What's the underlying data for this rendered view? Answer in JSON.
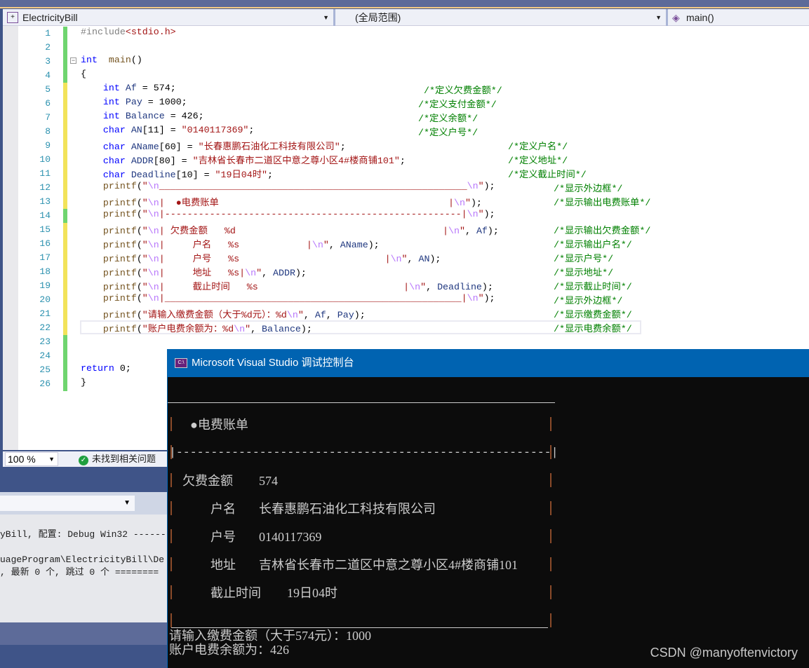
{
  "navbar": {
    "project": "ElectricityBill",
    "scope": "(全局范围)",
    "member": "main()"
  },
  "editor": {
    "line_numbers": [
      "1",
      "2",
      "3",
      "4",
      "5",
      "6",
      "7",
      "8",
      "9",
      "10",
      "11",
      "12",
      "13",
      "14",
      "15",
      "16",
      "17",
      "18",
      "19",
      "20",
      "21",
      "22",
      "23",
      "24",
      "25",
      "26"
    ],
    "change_marks": [
      "saved",
      "saved",
      "saved",
      "saved",
      "unsaved",
      "unsaved",
      "unsaved",
      "unsaved",
      "unsaved",
      "unsaved",
      "unsaved",
      "unsaved",
      "unsaved",
      "saved",
      "unsaved",
      "unsaved",
      "unsaved",
      "unsaved",
      "unsaved",
      "unsaved",
      "unsaved",
      "unsaved",
      "saved",
      "saved",
      "saved",
      "saved"
    ],
    "code": [
      [
        [
          "pp",
          "#include"
        ],
        [
          "str",
          "<stdio.h>"
        ]
      ],
      [],
      [
        [
          "kw",
          "int"
        ],
        [
          "",
          "  "
        ],
        [
          "fn",
          "main"
        ],
        [
          "",
          "()"
        ]
      ],
      [
        [
          "",
          "{"
        ]
      ],
      [
        [
          "",
          "    "
        ],
        [
          "kw",
          "int"
        ],
        [
          "",
          " "
        ],
        [
          "var",
          "Af"
        ],
        [
          "",
          " = 574;"
        ]
      ],
      [
        [
          "",
          "    "
        ],
        [
          "kw",
          "int"
        ],
        [
          "",
          " "
        ],
        [
          "var",
          "Pay"
        ],
        [
          "",
          " = 1000;"
        ]
      ],
      [
        [
          "",
          "    "
        ],
        [
          "kw",
          "int"
        ],
        [
          "",
          " "
        ],
        [
          "var",
          "Balance"
        ],
        [
          "",
          " = 426;"
        ]
      ],
      [
        [
          "",
          "    "
        ],
        [
          "kw",
          "char"
        ],
        [
          "",
          " "
        ],
        [
          "var",
          "AN"
        ],
        [
          "",
          "[11] = "
        ],
        [
          "str",
          "\"0140117369\""
        ],
        [
          "",
          ";"
        ]
      ],
      [
        [
          "",
          "    "
        ],
        [
          "kw",
          "char"
        ],
        [
          "",
          " "
        ],
        [
          "var",
          "AName"
        ],
        [
          "",
          "[60] = "
        ],
        [
          "str",
          "\"长春惠鹏石油化工科技有限公司\""
        ],
        [
          "",
          ";"
        ]
      ],
      [
        [
          "",
          "    "
        ],
        [
          "kw",
          "char"
        ],
        [
          "",
          " "
        ],
        [
          "var",
          "ADDR"
        ],
        [
          "",
          "[80] = "
        ],
        [
          "str",
          "\"吉林省长春市二道区中意之尊小区4#楼商铺101\""
        ],
        [
          "",
          ";"
        ]
      ],
      [
        [
          "",
          "    "
        ],
        [
          "kw",
          "char"
        ],
        [
          "",
          " "
        ],
        [
          "var",
          "Deadline"
        ],
        [
          "",
          "[10] = "
        ],
        [
          "str",
          "\"19日04时\""
        ],
        [
          "",
          ";"
        ]
      ],
      [
        [
          "",
          "    "
        ],
        [
          "fn",
          "printf"
        ],
        [
          "",
          "("
        ],
        [
          "str",
          "\""
        ],
        [
          "esc",
          "\\n"
        ],
        [
          "str",
          "_______________________________________________________"
        ],
        [
          "esc",
          "\\n"
        ],
        [
          "str",
          "\""
        ],
        [
          "",
          ");"
        ]
      ],
      [
        [
          "",
          "    "
        ],
        [
          "fn",
          "printf"
        ],
        [
          "",
          "("
        ],
        [
          "str",
          "\""
        ],
        [
          "esc",
          "\\n"
        ],
        [
          "str",
          "|  ●电费账单                                         |"
        ],
        [
          "esc",
          "\\n"
        ],
        [
          "str",
          "\""
        ],
        [
          "",
          ");"
        ]
      ],
      [
        [
          "",
          "    "
        ],
        [
          "fn",
          "printf"
        ],
        [
          "",
          "("
        ],
        [
          "str",
          "\""
        ],
        [
          "esc",
          "\\n"
        ],
        [
          "str",
          "|-----------------------------------------------------|"
        ],
        [
          "esc",
          "\\n"
        ],
        [
          "str",
          "\""
        ],
        [
          "",
          ");"
        ]
      ],
      [
        [
          "",
          "    "
        ],
        [
          "fn",
          "printf"
        ],
        [
          "",
          "("
        ],
        [
          "str",
          "\""
        ],
        [
          "esc",
          "\\n"
        ],
        [
          "str",
          "| 欠费金额   %d                                     |"
        ],
        [
          "esc",
          "\\n"
        ],
        [
          "str",
          "\""
        ],
        [
          "",
          ", "
        ],
        [
          "var",
          "Af"
        ],
        [
          "",
          ");"
        ]
      ],
      [
        [
          "",
          "    "
        ],
        [
          "fn",
          "printf"
        ],
        [
          "",
          "("
        ],
        [
          "str",
          "\""
        ],
        [
          "esc",
          "\\n"
        ],
        [
          "str",
          "|     户名   %s            |"
        ],
        [
          "esc",
          "\\n"
        ],
        [
          "str",
          "\""
        ],
        [
          "",
          ", "
        ],
        [
          "var",
          "AName"
        ],
        [
          "",
          ");"
        ]
      ],
      [
        [
          "",
          "    "
        ],
        [
          "fn",
          "printf"
        ],
        [
          "",
          "("
        ],
        [
          "str",
          "\""
        ],
        [
          "esc",
          "\\n"
        ],
        [
          "str",
          "|     户号   %s                          |"
        ],
        [
          "esc",
          "\\n"
        ],
        [
          "str",
          "\""
        ],
        [
          "",
          ", "
        ],
        [
          "var",
          "AN"
        ],
        [
          "",
          ");"
        ]
      ],
      [
        [
          "",
          "    "
        ],
        [
          "fn",
          "printf"
        ],
        [
          "",
          "("
        ],
        [
          "str",
          "\""
        ],
        [
          "esc",
          "\\n"
        ],
        [
          "str",
          "|     地址   %s|"
        ],
        [
          "esc",
          "\\n"
        ],
        [
          "str",
          "\""
        ],
        [
          "",
          ", "
        ],
        [
          "var",
          "ADDR"
        ],
        [
          "",
          ");"
        ]
      ],
      [
        [
          "",
          "    "
        ],
        [
          "fn",
          "printf"
        ],
        [
          "",
          "("
        ],
        [
          "str",
          "\""
        ],
        [
          "esc",
          "\\n"
        ],
        [
          "str",
          "|     截止时间   %s                          |"
        ],
        [
          "esc",
          "\\n"
        ],
        [
          "str",
          "\""
        ],
        [
          "",
          ", "
        ],
        [
          "var",
          "Deadline"
        ],
        [
          "",
          ");"
        ]
      ],
      [
        [
          "",
          "    "
        ],
        [
          "fn",
          "printf"
        ],
        [
          "",
          "("
        ],
        [
          "str",
          "\""
        ],
        [
          "esc",
          "\\n"
        ],
        [
          "str",
          "|_____________________________________________________|"
        ],
        [
          "esc",
          "\\n"
        ],
        [
          "str",
          "\""
        ],
        [
          "",
          ");"
        ]
      ],
      [
        [
          "",
          "    "
        ],
        [
          "fn",
          "printf"
        ],
        [
          "",
          "("
        ],
        [
          "str",
          "\"请输入缴费金额（大于%d元）：%d"
        ],
        [
          "esc",
          "\\n"
        ],
        [
          "str",
          "\""
        ],
        [
          "",
          ", "
        ],
        [
          "var",
          "Af"
        ],
        [
          "",
          ", "
        ],
        [
          "var",
          "Pay"
        ],
        [
          "",
          ");"
        ]
      ],
      [
        [
          "",
          "    "
        ],
        [
          "fn",
          "printf"
        ],
        [
          "",
          "("
        ],
        [
          "str",
          "\"账户电费余额为：%d"
        ],
        [
          "esc",
          "\\n"
        ],
        [
          "str",
          "\""
        ],
        [
          "",
          ", "
        ],
        [
          "var",
          "Balance"
        ],
        [
          "",
          ");"
        ]
      ],
      [],
      [],
      [
        [
          "kw",
          "return"
        ],
        [
          "",
          " 0;"
        ]
      ],
      [
        [
          "",
          "}"
        ]
      ]
    ],
    "comments": [
      "",
      "",
      "",
      "",
      "/*定义欠费金额*/",
      "/*定义支付金额*/",
      "/*定义余额*/",
      "/*定义户号*/",
      "/*定义户名*/",
      "/*定义地址*/",
      "/*定义截止时间*/",
      "/*显示外边框*/",
      "/*显示输出电费账单*/",
      "",
      "/*显示输出欠费金额*/",
      "/*显示输出户名*/",
      "/*显示户号*/",
      "/*显示地址*/",
      "/*显示截止时间*/",
      "/*显示外边框*/",
      "/*显示缴费金额*/",
      "/*显示电费余额*/",
      "",
      "",
      "",
      ""
    ]
  },
  "status": {
    "zoom": "100 %",
    "issues": "未找到相关问题"
  },
  "output": {
    "lines": [
      "yBill, 配置: Debug Win32 ------",
      "",
      "uageProgram\\ElectricityBill\\De",
      ", 最新 0 个, 跳过 0 个 ========"
    ]
  },
  "console": {
    "title": "Microsoft Visual Studio 调试控制台",
    "icon_label": "C:\\",
    "bill_title": "●电费账单",
    "separator": "|------------------------------------------------------|",
    "rows": [
      {
        "label": "欠费金额",
        "value": "574"
      },
      {
        "label": "户名",
        "value": "长春惠鹏石油化工科技有限公司"
      },
      {
        "label": "户号",
        "value": "0140117369"
      },
      {
        "label": "地址",
        "value": "吉林省长春市二道区中意之尊小区4#楼商铺101"
      },
      {
        "label": "截止时间",
        "value": "19日04时"
      }
    ],
    "prompt_line": "请输入缴费金额（大于574元）：1000",
    "balance_line": "账户电费余额为：426"
  },
  "watermark": "CSDN @manyoftenvictory",
  "colors": {
    "console_title": "#0063b1",
    "console_bg": "#0c0c0c",
    "saved_mark": "#6fd56f",
    "unsaved_mark": "#f2e35a"
  }
}
